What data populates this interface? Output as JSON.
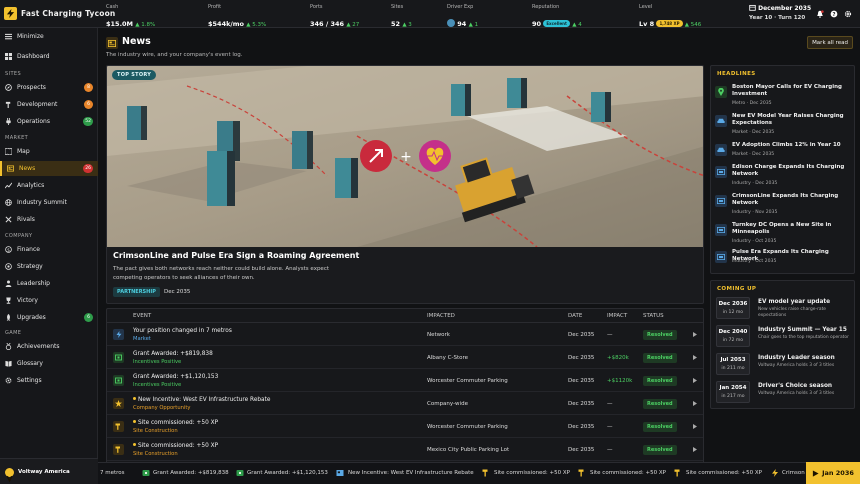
{
  "app": {
    "title": "Fast Charging Tycoon"
  },
  "topbar": {
    "stats": [
      {
        "label": "Cash",
        "value": "$15.0M",
        "delta": "1.8%"
      },
      {
        "label": "Profit",
        "value": "$544k/mo",
        "delta": "5.3%"
      },
      {
        "label": "Ports",
        "value": "346 / 346",
        "delta": "27"
      },
      {
        "label": "Sites",
        "value": "52",
        "delta": "3"
      },
      {
        "label": "Driver Exp",
        "value": "94",
        "delta": "1"
      },
      {
        "label": "Reputation",
        "value": "90",
        "badge": "Excellent",
        "delta": "4"
      },
      {
        "label": "Level",
        "value": "Lv 8",
        "badge": "1,748 XP",
        "delta": "546"
      }
    ],
    "date": {
      "month": "December 2035",
      "sub": "Year 10 · Turn 120"
    },
    "icons": [
      "bell-icon",
      "help-icon",
      "gear-icon"
    ],
    "accent": "#f2c12e"
  },
  "sidebar": {
    "minimize": "Minimize",
    "dashboard": "Dashboard",
    "sections": {
      "sites": "SITES",
      "market": "MARKET",
      "company": "COMPANY",
      "game": "GAME"
    },
    "items": {
      "prospects": {
        "label": "Prospects",
        "badge": "8"
      },
      "development": {
        "label": "Development",
        "badge": "6"
      },
      "operations": {
        "label": "Operations",
        "badge": "52"
      },
      "map": {
        "label": "Map"
      },
      "news": {
        "label": "News",
        "badge": "26"
      },
      "analytics": {
        "label": "Analytics"
      },
      "summit": {
        "label": "Industry Summit"
      },
      "rivals": {
        "label": "Rivals"
      },
      "finance": {
        "label": "Finance"
      },
      "strategy": {
        "label": "Strategy"
      },
      "leadership": {
        "label": "Leadership"
      },
      "victory": {
        "label": "Victory"
      },
      "upgrades": {
        "label": "Upgrades",
        "badge": "6"
      },
      "achievements": {
        "label": "Achievements"
      },
      "glossary": {
        "label": "Glossary"
      },
      "settings": {
        "label": "Settings"
      }
    },
    "company": "Voltway America"
  },
  "page": {
    "title": "News",
    "subtitle": "The industry wire, and your company's event log.",
    "mark_all": "Mark all read"
  },
  "top_story": {
    "tag": "TOP STORY",
    "title": "CrimsonLine and Pulse Era Sign a Roaming Agreement",
    "description": "The pact gives both networks reach neither could build alone. Analysts expect competing operators to seek alliances of their own.",
    "category": "PARTNERSHIP",
    "date": "Dec 2035"
  },
  "events": {
    "columns": {
      "event": "EVENT",
      "impacted": "IMPACTED",
      "date": "DATE",
      "impact": "IMPACT",
      "status": "STATUS"
    },
    "rows": [
      {
        "title": "Your position changed in 7 metros",
        "sub": "Market",
        "impacted": "Network",
        "date": "Dec 2035",
        "impact": "—",
        "status": "Resolved"
      },
      {
        "title": "Grant Awarded: +$819,838",
        "sub": "Incentives Positive",
        "impacted": "Albany C-Store",
        "date": "Dec 2035",
        "impact": "+$820k",
        "status": "Resolved"
      },
      {
        "title": "Grant Awarded: +$1,120,153",
        "sub": "Incentives Positive",
        "impacted": "Worcester Commuter Parking",
        "date": "Dec 2035",
        "impact": "+$1120k",
        "status": "Resolved"
      },
      {
        "title": "New Incentive: West EV Infrastructure Rebate",
        "sub": "Company Opportunity",
        "impacted": "Company-wide",
        "date": "Dec 2035",
        "impact": "—",
        "status": "Resolved"
      },
      {
        "title": "Site commissioned: +50 XP",
        "sub": "Site Construction",
        "impacted": "Worcester Commuter Parking",
        "date": "Dec 2035",
        "impact": "—",
        "status": "Resolved"
      },
      {
        "title": "Site commissioned: +50 XP",
        "sub": "Site Construction",
        "impacted": "Mexico City Public Parking Lot",
        "date": "Dec 2035",
        "impact": "—",
        "status": "Resolved"
      }
    ]
  },
  "headlines": {
    "title": "HEADLINES",
    "items": [
      {
        "title": "Boston Mayor Calls for EV Charging Investment",
        "meta": "Metro · Dec 2035"
      },
      {
        "title": "New EV Model Year Raises Charging Expectations",
        "meta": "Market · Dec 2035"
      },
      {
        "title": "EV Adoption Climbs 12% in Year 10",
        "meta": "Market · Dec 2035"
      },
      {
        "title": "Edison Charge Expands Its Charging Network",
        "meta": "Industry · Dec 2035"
      },
      {
        "title": "CrimsonLine Expands Its Charging Network",
        "meta": "Industry · Nov 2035"
      },
      {
        "title": "Turnkey DC Opens a New Site in Minneapolis",
        "meta": "Industry · Oct 2035"
      },
      {
        "title": "Pulse Era Expands Its Charging Network",
        "meta": "Industry · Oct 2035"
      }
    ]
  },
  "upcoming": {
    "title": "COMING UP",
    "items": [
      {
        "date": "Dec 2036",
        "in": "in 12 mo",
        "title": "EV model year update",
        "desc": "New vehicles raise charge-rate expectations"
      },
      {
        "date": "Dec 2040",
        "in": "in 72 mo",
        "title": "Industry Summit — Year 15",
        "desc": "Chair goes to the top reputation operator"
      },
      {
        "date": "Jul 2053",
        "in": "in 211 mo",
        "title": "Industry Leader season",
        "desc": "Voltway America holds 3 of 3 titles"
      },
      {
        "date": "Jan 2054",
        "in": "in 217 mo",
        "title": "Driver's Choice season",
        "desc": "Voltway America holds 3 of 3 titles"
      }
    ]
  },
  "ticker": {
    "items": [
      "7 metros",
      "Grant Awarded: +$819,838",
      "Grant Awarded: +$1,120,153",
      "New Incentive: West EV Infrastructure Rebate",
      "Site commissioned: +50 XP",
      "Site commissioned: +50 XP",
      "Site commissioned: +50 XP",
      "Crimson"
    ]
  },
  "next_turn": {
    "label": "Jan 2036"
  }
}
